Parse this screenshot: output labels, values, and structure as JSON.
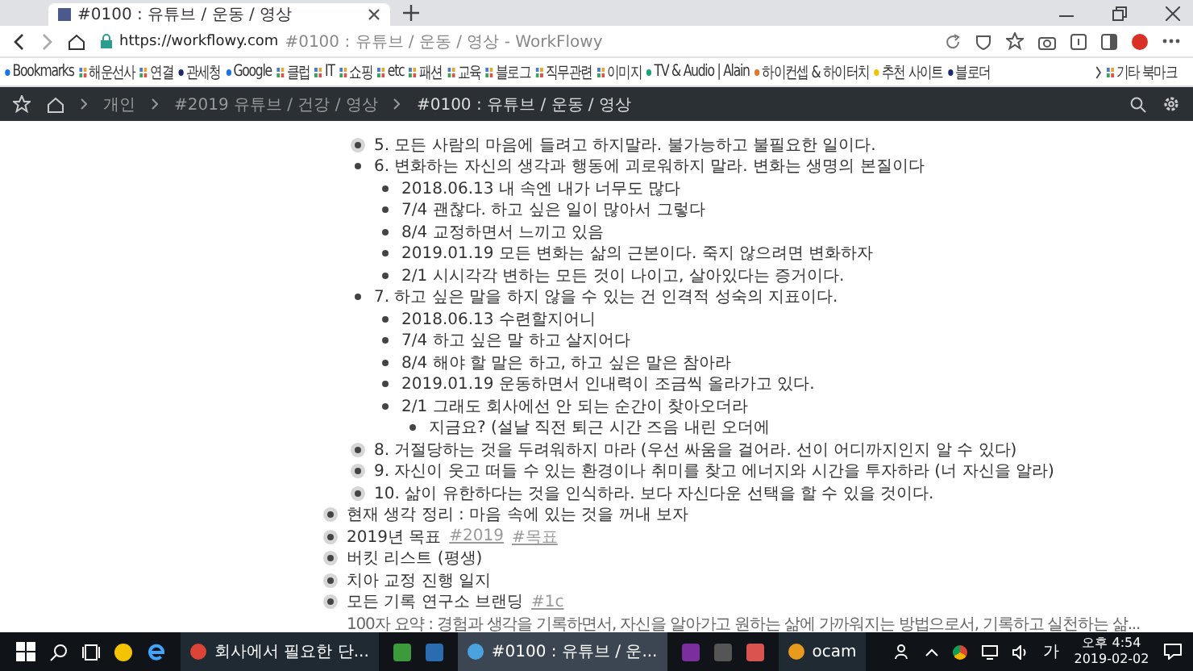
{
  "browser": {
    "tab": {
      "title": "#0100 : 유튜브 / 운동 / 영상",
      "selected": true
    },
    "address": {
      "url": "https://workflowy.com",
      "title": "#0100 : 유튜브 / 운동 / 영상 - WorkFlowy"
    },
    "bookmarks": [
      {
        "label": "Bookmarks",
        "kind": "dot",
        "color": "#1a73e8"
      },
      {
        "label": "해운선사",
        "kind": "folder"
      },
      {
        "label": "연결",
        "kind": "folder"
      },
      {
        "label": "관세청",
        "kind": "dot",
        "color": "#1a2a6c"
      },
      {
        "label": "Google",
        "kind": "dot",
        "color": "#1a73e8"
      },
      {
        "label": "클럽",
        "kind": "folder"
      },
      {
        "label": "IT",
        "kind": "folder"
      },
      {
        "label": "쇼핑",
        "kind": "folder"
      },
      {
        "label": "etc",
        "kind": "folder"
      },
      {
        "label": "패션",
        "kind": "folder"
      },
      {
        "label": "교육",
        "kind": "folder"
      },
      {
        "label": "블로그",
        "kind": "folder"
      },
      {
        "label": "직무관련",
        "kind": "folder"
      },
      {
        "label": "이미지",
        "kind": "folder"
      },
      {
        "label": "TV & Audio | Alain",
        "kind": "dot",
        "color": "#1aa37a"
      },
      {
        "label": "하이컨셉 & 하이터치",
        "kind": "dot",
        "color": "#e0782a"
      },
      {
        "label": "추천 사이트",
        "kind": "dot",
        "color": "#f2c200"
      },
      {
        "label": "블로더",
        "kind": "dot",
        "color": "#1a2a6c"
      }
    ],
    "other_bookmarks": "기타 북마크"
  },
  "workflowy": {
    "breadcrumbs": [
      "개인",
      "#2019 유튜브 / 건강 / 영상",
      "#0100 : 유튜브 / 운동 / 영상"
    ],
    "continued_items": [
      {
        "text": "5. 모든 사람의 마음에 들려고 하지말라. 불가능하고 불필요한 일이다.",
        "collapsed": true
      },
      {
        "text": "6. 변화하는 자신의 생각과 행동에 괴로워하지 말라. 변화는 생명의 본질이다",
        "collapsed": false,
        "children": [
          {
            "text": "2018.06.13 내 속엔 내가 너무도 많다",
            "collapsed": false
          },
          {
            "text": "7/4 괜찮다. 하고 싶은 일이 많아서 그렇다",
            "collapsed": false
          },
          {
            "text": "8/4 교정하면서 느끼고 있음",
            "collapsed": false
          },
          {
            "text": "2019.01.19 모든 변화는 삶의 근본이다. 죽지 않으려면 변화하자",
            "collapsed": false
          },
          {
            "text": "2/1 시시각각 변하는 모든 것이 나이고, 살아있다는 증거이다.",
            "collapsed": false
          }
        ]
      },
      {
        "text": "7. 하고 싶은 말을 하지 않을 수 있는 건 인격적 성숙의 지표이다.",
        "collapsed": false,
        "children": [
          {
            "text": "2018.06.13 수련할지어니",
            "collapsed": false
          },
          {
            "text": "7/4 하고 싶은 말 하고 살지어다",
            "collapsed": false
          },
          {
            "text": "8/4 해야 할 말은 하고, 하고 싶은 말은 참아라",
            "collapsed": false
          },
          {
            "text": "2019.01.19 운동하면서 인내력이 조금씩 올라가고 있다.",
            "collapsed": false
          },
          {
            "text": "2/1 그래도 회사에선 안 되는 순간이 찾아오더라",
            "collapsed": false,
            "children": [
              {
                "text": "지금요? (설날 직전 퇴근 시간 즈음 내린 오더에",
                "collapsed": false
              }
            ]
          }
        ]
      },
      {
        "text": "8. 거절당하는 것을 두려워하지 마라 (우선 싸움을 걸어라. 선이 어디까지인지 알 수 있다)",
        "collapsed": true
      },
      {
        "text": "9. 자신이 웃고 떠들 수 있는 환경이나 취미를 찾고 에너지와 시간을 투자하라 (너 자신을 알라)",
        "collapsed": true
      },
      {
        "text": "10. 삶이 유한하다는 것을 인식하라. 보다 자신다운 선택을 할 수 있을 것이다.",
        "collapsed": true
      }
    ],
    "outline": [
      {
        "text": "현재 생각 정리 : 마음 속에 있는 것을 꺼내 보자",
        "collapsed": true
      },
      {
        "text": "2019년 목표",
        "tags": [
          "#2019",
          "#목표"
        ],
        "collapsed": true
      },
      {
        "text": "버킷 리스트 (평생)",
        "collapsed": true
      },
      {
        "text": "치아 교정 진행 일지",
        "collapsed": true
      },
      {
        "text": "모든 기록 연구소 브랜딩",
        "tags": [
          "#1c"
        ],
        "collapsed": true,
        "note": "100자 요약 : 경험과 생각을 기록하면서, 자신을 알아가고 원하는 삶에 가까워지는 방법으로서, 기록하고 실천하는 삶..."
      }
    ]
  },
  "taskbar": {
    "apps": [
      {
        "label": "회사에서 필요한 단...",
        "kind": "chrome",
        "selected": false
      },
      {
        "kind": "green"
      },
      {
        "kind": "blue"
      },
      {
        "label": "#0100 : 유튜브 / 운...",
        "kind": "workflowy",
        "selected": true
      },
      {
        "kind": "onenote"
      },
      {
        "kind": "calc"
      },
      {
        "kind": "sync"
      },
      {
        "label": "ocam",
        "kind": "ocam",
        "selected": false
      }
    ],
    "ime": "가",
    "time": "오후 4:54",
    "date": "2019-02-02"
  }
}
